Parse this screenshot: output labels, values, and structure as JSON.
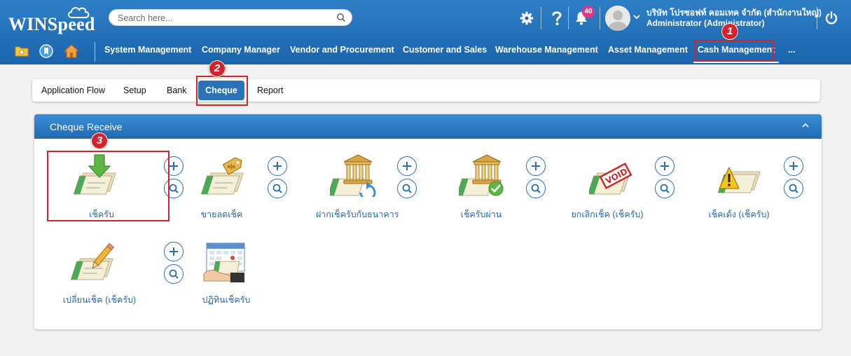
{
  "header": {
    "logo_text": "WINSpeed",
    "search_placeholder": "Search here...",
    "notification_count": "40",
    "company_name": "บริษัท โปรซอฟท์ คอมเทค จำกัด (สำนักงานใหญ่)",
    "user_name": "Administrator (Administrator)"
  },
  "menu": {
    "items": [
      {
        "label": "System Management"
      },
      {
        "label": "Company Manager"
      },
      {
        "label": "Vendor and Procurement"
      },
      {
        "label": "Customer and Sales"
      },
      {
        "label": "Warehouse Management"
      },
      {
        "label": "Asset Management"
      },
      {
        "label": "Cash Management"
      },
      {
        "label": "..."
      }
    ],
    "active": "Cash Management"
  },
  "subtabs": {
    "items": [
      {
        "label": "Application Flow"
      },
      {
        "label": "Setup"
      },
      {
        "label": "Bank"
      },
      {
        "label": "Cheque"
      },
      {
        "label": "Report"
      }
    ],
    "active": "Cheque"
  },
  "panel": {
    "title": "Cheque Receive",
    "tiles": [
      {
        "label": "เช็ครับ",
        "icon": "cheque-receive-arrow-icon"
      },
      {
        "label": "ขายลดเช็ค",
        "icon": "cheque-discount-tag-icon"
      },
      {
        "label": "ฝากเช็ครับกับธนาคาร",
        "icon": "cheque-bank-deposit-icon"
      },
      {
        "label": "เช็ครับผ่าน",
        "icon": "cheque-bank-check-icon"
      },
      {
        "label": "ยกเลิกเช็ค (เช็ครับ)",
        "icon": "cheque-void-icon"
      },
      {
        "label": "เช็คเด้ง (เช็ครับ)",
        "icon": "cheque-warning-icon"
      },
      {
        "label": "เปลี่ยนเช็ค (เช็ครับ)",
        "icon": "cheque-pencil-icon"
      },
      {
        "label": "ปฏิทินเช็ครับ",
        "icon": "cheque-calendar-icon"
      }
    ]
  },
  "annotations": [
    "1",
    "2",
    "3"
  ],
  "colors": {
    "header_blue": "#1a64ad",
    "active_tab": "#2a73b8",
    "link_blue": "#2468b1",
    "highlight_red": "#d4232c",
    "badge_pink": "#e0368a"
  }
}
